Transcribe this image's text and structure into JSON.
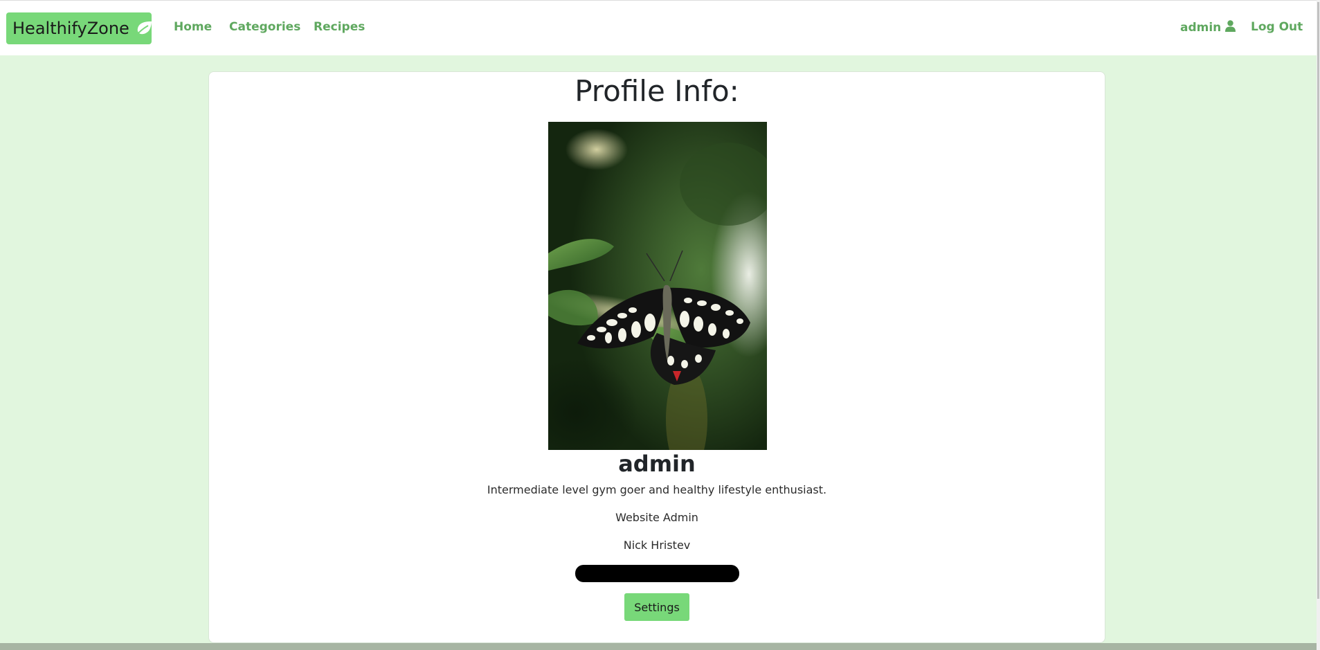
{
  "nav": {
    "brand": "HealthifyZone",
    "home": "Home",
    "categories": "Categories",
    "recipes": "Recipes",
    "user": "admin",
    "logout": "Log Out"
  },
  "profile": {
    "title": "Profile Info:",
    "photo_subject": "butterfly-on-leaf",
    "username": "admin",
    "bio": "Intermediate level gym goer and healthy lifestyle enthusiast.",
    "role": "Website Admin",
    "full_name": "Nick Hristev",
    "settings_label": "Settings"
  },
  "colors": {
    "brand_bg": "#78d879",
    "nav_link": "#5fa85f",
    "page_bg": "#e1f6de",
    "card_bg": "#ffffff"
  }
}
